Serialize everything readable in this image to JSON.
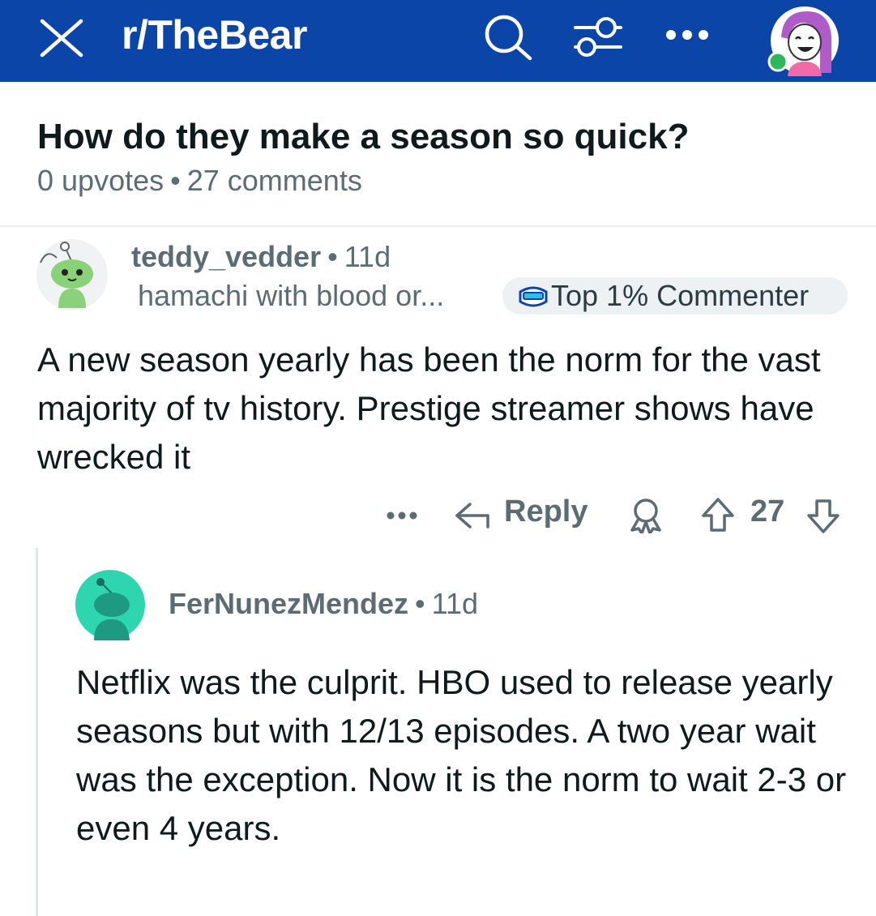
{
  "header": {
    "subreddit": "r/TheBear",
    "icons": [
      "close-icon",
      "search-icon",
      "filter-icon",
      "more-icon",
      "avatar"
    ]
  },
  "post": {
    "title": "How do they make a season so quick?",
    "upvotes": "0 upvotes",
    "separator": "•",
    "comments": "27 comments"
  },
  "comments": [
    {
      "username": "teddy_vedder",
      "age": "11d",
      "flair": "hamachi with blood or...",
      "badge": "Top 1% Commenter",
      "body": "A new season yearly has been the norm for the vast majority of tv history. Prestige streamer shows have wrecked it",
      "actions": {
        "reply_label": "Reply",
        "score": "27"
      }
    },
    {
      "username": "FerNunezMendez",
      "age": "11d",
      "body": "Netflix was the culprit. HBO used to release yearly seasons but with 12/13 episodes. A two year wait was the exception. Now it is the norm to wait 2-3 or even 4 years."
    }
  ],
  "colors": {
    "header_bg": "#0c45a8",
    "meta_gray": "#5c6c74",
    "badge_bg": "#eef1f3",
    "online_dot": "#2eb85c"
  }
}
